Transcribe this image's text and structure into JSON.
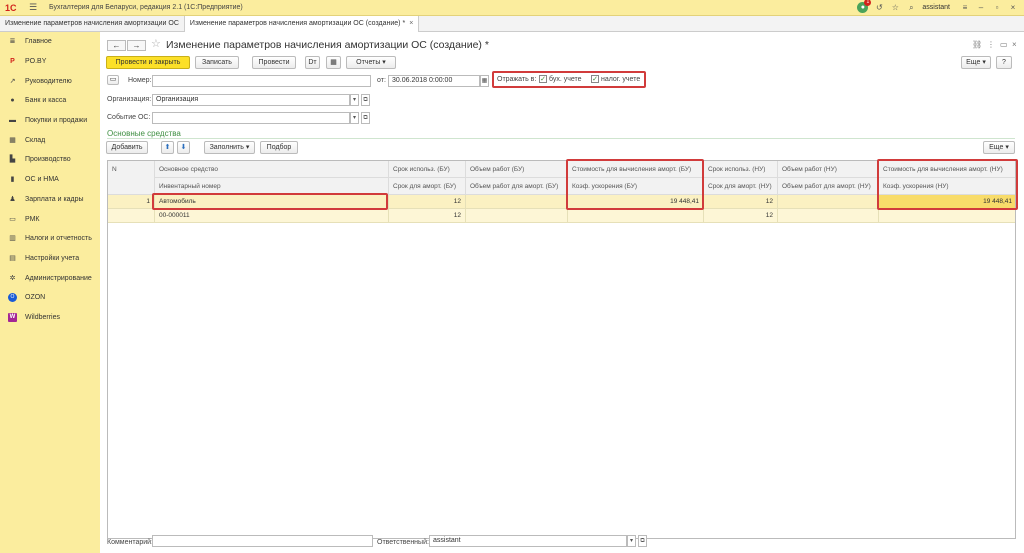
{
  "titlebar": {
    "logo": "1С",
    "app_title": "Бухгалтерия для Беларуси, редакция 2.1  (1С:Предприятие)",
    "notifications": "1",
    "user": "assistant"
  },
  "tabs": [
    {
      "label": "Изменение параметров начисления амортизации ОС"
    },
    {
      "label": "Изменение параметров начисления амортизации ОС (создание) *",
      "close": "×"
    }
  ],
  "sidebar": {
    "items": [
      {
        "label": "Главное",
        "icon": "menu-icon"
      },
      {
        "label": "PO.BY",
        "icon": "po-by-icon"
      },
      {
        "label": "Руководителю",
        "icon": "chart-icon"
      },
      {
        "label": "Банк и касса",
        "icon": "bank-icon"
      },
      {
        "label": "Покупки и продажи",
        "icon": "cart-icon"
      },
      {
        "label": "Склад",
        "icon": "warehouse-icon"
      },
      {
        "label": "Производство",
        "icon": "factory-icon"
      },
      {
        "label": "ОС и НМА",
        "icon": "assets-icon"
      },
      {
        "label": "Зарплата и кадры",
        "icon": "people-icon"
      },
      {
        "label": "РМК",
        "icon": "register-icon"
      },
      {
        "label": "Налоги и отчетность",
        "icon": "taxes-icon"
      },
      {
        "label": "Настройки учета",
        "icon": "settings-icon"
      },
      {
        "label": "Администрирование",
        "icon": "gear-icon"
      },
      {
        "label": "OZON",
        "icon": "ozon-icon"
      },
      {
        "label": "Wildberries",
        "icon": "wildberries-icon"
      }
    ]
  },
  "form": {
    "title": "Изменение параметров начисления амортизации ОС (создание) *",
    "toolbar": {
      "post_close": "Провести и закрыть",
      "save": "Записать",
      "post": "Провести",
      "reports": "Отчеты",
      "more": "Еще",
      "help": "?"
    },
    "number_label": "Номер:",
    "number_value": "",
    "date_label": "от:",
    "date_value": "30.06.2018  0:00:00",
    "reflect_label": "Отражать в:",
    "reflect_bu": {
      "label": "бух. учете",
      "checked": true
    },
    "reflect_nu": {
      "label": "налог. учете",
      "checked": true
    },
    "org_label": "Организация:",
    "org_value": "Организация",
    "event_label": "Событие ОС:",
    "event_value": "",
    "section_title": "Основные средства",
    "table_toolbar": {
      "add": "Добавить",
      "fill": "Заполнить",
      "select": "Подбор",
      "more": "Еще"
    },
    "comment_label": "Комментарий:",
    "comment_value": "",
    "responsible_label": "Ответственный:",
    "responsible_value": "assistant"
  },
  "table": {
    "header_top": [
      "N",
      "Основное средство",
      "Срок использ. (БУ)",
      "Объем работ (БУ)",
      "Стоимость для вычисления аморт. (БУ)",
      "Срок использ. (НУ)",
      "Объем работ (НУ)",
      "Стоимость для вычисления аморт. (НУ)"
    ],
    "header_bottom": [
      "",
      "Инвентарный номер",
      "Срок для аморт. (БУ)",
      "Объем работ для аморт. (БУ)",
      "Коэф. ускорения (БУ)",
      "Срок для аморт. (НУ)",
      "Объем работ для аморт. (НУ)",
      "Коэф. ускорения (НУ)"
    ],
    "rows": [
      {
        "n": "1",
        "asset": "Автомобиль",
        "inventory_no": "00-000011",
        "term_bu": "12",
        "term_amort_bu": "12",
        "volume_bu": "",
        "volume_amort_bu": "",
        "cost_bu": "19 448,41",
        "coef_bu": "",
        "term_nu": "12",
        "term_amort_nu": "12",
        "volume_nu": "",
        "volume_amort_nu": "",
        "cost_nu": "19 448,41",
        "coef_nu": ""
      }
    ]
  },
  "colors": {
    "sidebar_bg": "#fbed9e",
    "primary_button": "#fce028",
    "highlight_border": "#d13b3b",
    "section_green": "#3f8f42"
  }
}
